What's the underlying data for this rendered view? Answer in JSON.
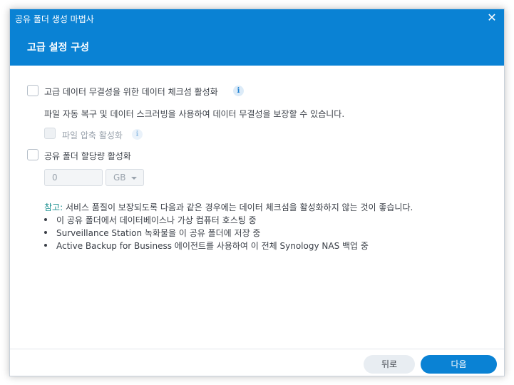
{
  "window": {
    "title": "공유 폴더 생성 마법사",
    "close_glyph": "✕"
  },
  "header": {
    "title": "고급 설정 구성"
  },
  "options": {
    "checksum": {
      "label": "고급 데이터 무결성을 위한 데이터 체크섬 활성화",
      "checked": false,
      "description": "파일 자동 복구 및 데이터 스크러빙을 사용하여 데이터 무결성을 보장할 수 있습니다."
    },
    "compression": {
      "label": "파일 압축 활성화",
      "checked": false,
      "disabled": true
    },
    "quota": {
      "label": "공유 폴더 할당량 활성화",
      "checked": false,
      "value": "0",
      "unit": "GB"
    }
  },
  "note": {
    "prefix": "참고:",
    "text": " 서비스 품질이 보장되도록 다음과 같은 경우에는 데이터 체크섬을 활성화하지 않는 것이 좋습니다.",
    "items": [
      "이 공유 폴더에서 데이터베이스나 가상 컴퓨터 호스팅 중",
      "Surveillance Station 녹화물을 이 공유 폴더에 저장 중",
      "Active Backup for Business 에이전트를 사용하여 이 전체 Synology NAS 백업 중"
    ]
  },
  "footer": {
    "back_label": "뒤로",
    "next_label": "다음"
  },
  "icons": {
    "info": "i"
  },
  "colors": {
    "accent": "#0a82d4",
    "note_prefix": "#1a8f8f"
  }
}
